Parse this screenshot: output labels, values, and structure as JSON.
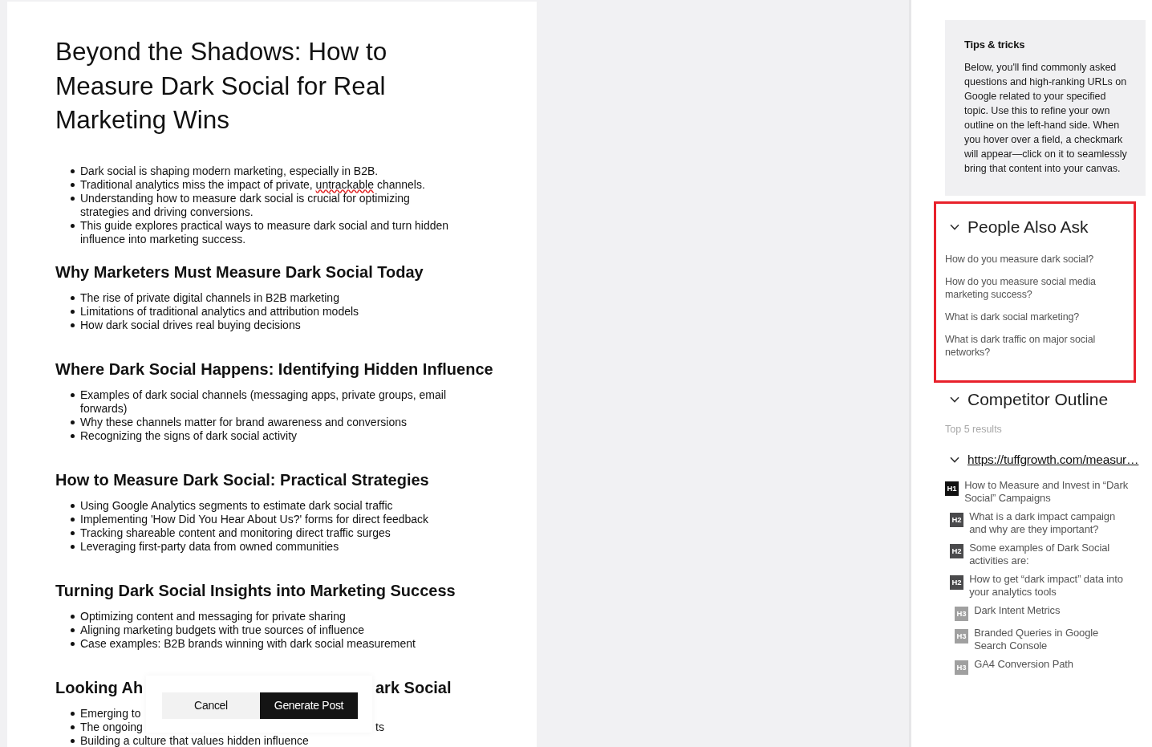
{
  "document": {
    "title": "Beyond the Shadows: How to Measure Dark Social for Real Marketing Wins",
    "intro_bullets": [
      {
        "text": "Dark social is shaping modern marketing, especially in B2B."
      },
      {
        "parts": [
          {
            "text": "Traditional analytics miss the impact of private, "
          },
          {
            "text": "untrackable",
            "misspelled": true
          },
          {
            "text": " channels."
          }
        ]
      },
      {
        "text": "Understanding how to measure dark social is crucial for optimizing strategies and driving conversions."
      },
      {
        "text": "This guide explores practical ways to measure dark social and turn hidden influence into marketing success."
      }
    ],
    "sections": [
      {
        "heading": "Why Marketers Must Measure Dark Social Today",
        "bullets": [
          {
            "text": "The rise of private digital channels in B2B marketing"
          },
          {
            "text": "Limitations of traditional analytics and attribution models"
          },
          {
            "text": "How dark social drives real buying decisions"
          }
        ]
      },
      {
        "heading": "Where Dark Social Happens: Identifying Hidden Influence",
        "bullets": [
          {
            "text": "Examples of dark social channels (messaging apps, private groups, email forwards)"
          },
          {
            "text": "Why these channels matter for brand awareness and conversions"
          },
          {
            "text": "Recognizing the signs of dark social activity"
          }
        ]
      },
      {
        "heading": "How to Measure Dark Social: Practical Strategies",
        "bullets": [
          {
            "text": "Using Google Analytics segments to estimate dark social traffic"
          },
          {
            "text": "Implementing 'How Did You Hear About Us?' forms for direct feedback"
          },
          {
            "text": "Tracking shareable content and monitoring direct traffic surges"
          },
          {
            "text": "Leveraging first-party data from owned communities"
          }
        ]
      },
      {
        "heading": "Turning Dark Social Insights into Marketing Success",
        "bullets": [
          {
            "text": "Optimizing content and messaging for private sharing"
          },
          {
            "text": "Aligning marketing budgets with true sources of influence"
          },
          {
            "text": "Case examples: B2B brands winning with dark social measurement"
          }
        ]
      },
      {
        "heading": "Looking Ah",
        "heading_right": "ark Social",
        "bullets": [
          {
            "text": "Emerging to"
          },
          {
            "text": "The ongoing",
            "text_right": "ts"
          },
          {
            "text": "Building a culture that values hidden influence"
          }
        ]
      }
    ]
  },
  "action_bar": {
    "buttons": [
      {
        "label": "Cancel",
        "kind": "secondary"
      },
      {
        "label": "Generate Post",
        "kind": "primary"
      }
    ]
  },
  "sidebar": {
    "tips": {
      "title": "Tips & tricks",
      "body": "Below, you'll find commonly asked questions and high-ranking URLs on Google related to your specified topic. Use this to refine your own outline on the left-hand side. When you hover over a field, a checkmark will appear—click on it to seamlessly bring that content into your canvas."
    },
    "people_also_ask": {
      "title": "People Also Ask",
      "expanded": true,
      "highlighted": true,
      "questions": [
        "How do you measure dark social?",
        "How do you measure social media marketing success?",
        "What is dark social marketing?",
        "What is dark traffic on major social networks?"
      ]
    },
    "competitor_outline": {
      "title": "Competitor Outline",
      "expanded": true,
      "subtitle": "Top 5 results",
      "results": [
        {
          "url": "https://tuffgrowth.com/measur…",
          "expanded": true,
          "outline": [
            {
              "tag": "H1",
              "text": "How to Measure and Invest in “Dark Social” Campaigns",
              "children": [
                {
                  "tag": "H2",
                  "text": "What is a dark impact campaign and why are they important?"
                },
                {
                  "tag": "H2",
                  "text": "Some examples of Dark Social activities are:"
                },
                {
                  "tag": "H2",
                  "text": "How to get “dark impact” data into your analytics tools",
                  "children": [
                    {
                      "tag": "H3",
                      "text": "Dark Intent Metrics"
                    },
                    {
                      "tag": "H3",
                      "text": "Branded Queries in Google Search Console"
                    },
                    {
                      "tag": "H3",
                      "text": "GA4 Conversion Path"
                    }
                  ]
                }
              ]
            }
          ]
        }
      ]
    }
  }
}
